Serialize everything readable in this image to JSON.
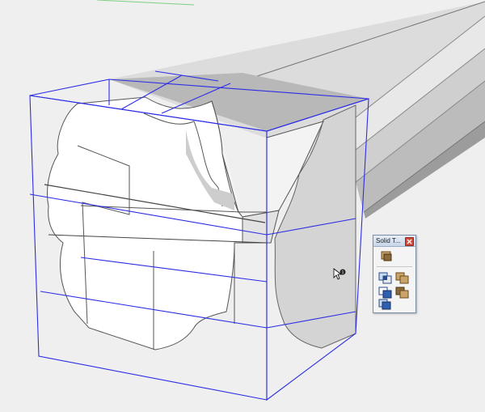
{
  "toolbar": {
    "title": "Solid T..."
  },
  "icons": {
    "close": "close-icon",
    "cursor": "pointer-cursor-with-badge",
    "tools": [
      "outer-shell-icon",
      "intersect-icon",
      "union-icon",
      "subtract-icon",
      "trim-icon",
      "split-icon"
    ]
  },
  "colors": {
    "selection": "#2d2de6",
    "background": "#efefef",
    "model": "#ffffff"
  }
}
